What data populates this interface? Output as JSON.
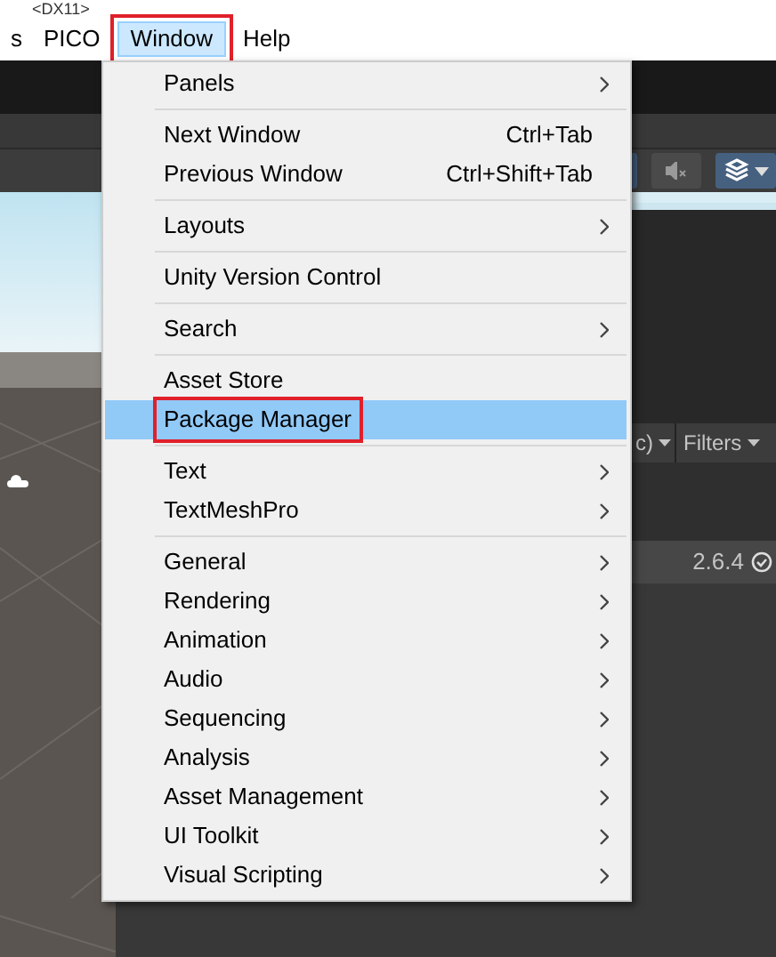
{
  "title_bar": {
    "title": "<DX11>"
  },
  "menubar": [
    {
      "label": "s",
      "selected": false
    },
    {
      "label": "PICO",
      "selected": false
    },
    {
      "label": "Window",
      "selected": true
    },
    {
      "label": "Help",
      "selected": false
    }
  ],
  "inspector": {
    "dropdown": "c)",
    "filters": "Filters",
    "package_version": "2.6.4"
  },
  "menu": {
    "items": [
      {
        "kind": "item",
        "label": "Panels",
        "submenu": true,
        "selected": false
      },
      {
        "kind": "separator"
      },
      {
        "kind": "item",
        "label": "Next Window",
        "shortcut": "Ctrl+Tab",
        "submenu": false,
        "selected": false
      },
      {
        "kind": "item",
        "label": "Previous Window",
        "shortcut": "Ctrl+Shift+Tab",
        "submenu": false,
        "selected": false
      },
      {
        "kind": "separator"
      },
      {
        "kind": "item",
        "label": "Layouts",
        "submenu": true,
        "selected": false
      },
      {
        "kind": "separator"
      },
      {
        "kind": "item",
        "label": "Unity Version Control",
        "submenu": false,
        "selected": false
      },
      {
        "kind": "separator"
      },
      {
        "kind": "item",
        "label": "Search",
        "submenu": true,
        "selected": false
      },
      {
        "kind": "separator"
      },
      {
        "kind": "item",
        "label": "Asset Store",
        "submenu": false,
        "selected": false
      },
      {
        "kind": "item",
        "label": "Package Manager",
        "submenu": false,
        "selected": true
      },
      {
        "kind": "separator"
      },
      {
        "kind": "item",
        "label": "Text",
        "submenu": true,
        "selected": false
      },
      {
        "kind": "item",
        "label": "TextMeshPro",
        "submenu": true,
        "selected": false
      },
      {
        "kind": "separator"
      },
      {
        "kind": "item",
        "label": "General",
        "submenu": true,
        "selected": false
      },
      {
        "kind": "item",
        "label": "Rendering",
        "submenu": true,
        "selected": false
      },
      {
        "kind": "item",
        "label": "Animation",
        "submenu": true,
        "selected": false
      },
      {
        "kind": "item",
        "label": "Audio",
        "submenu": true,
        "selected": false
      },
      {
        "kind": "item",
        "label": "Sequencing",
        "submenu": true,
        "selected": false
      },
      {
        "kind": "item",
        "label": "Analysis",
        "submenu": true,
        "selected": false
      },
      {
        "kind": "item",
        "label": "Asset Management",
        "submenu": true,
        "selected": false
      },
      {
        "kind": "item",
        "label": "UI Toolkit",
        "submenu": true,
        "selected": false
      },
      {
        "kind": "item",
        "label": "Visual Scripting",
        "submenu": true,
        "selected": false
      }
    ]
  }
}
